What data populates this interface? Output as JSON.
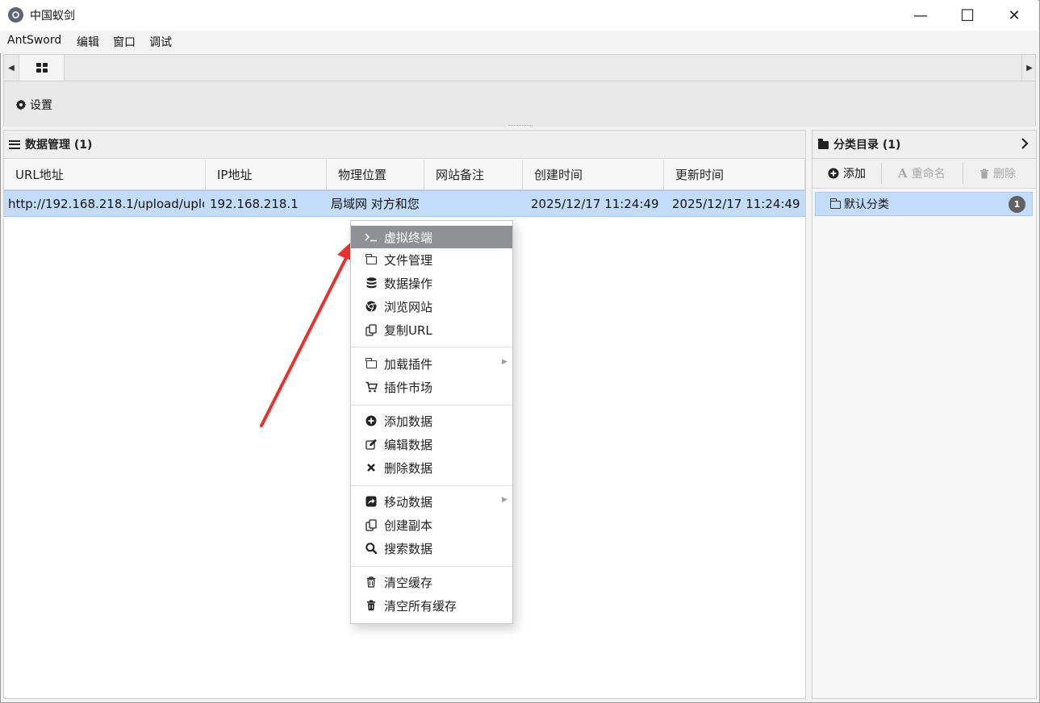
{
  "window": {
    "title": "中国蚁剑",
    "controls": {
      "minimize": "—",
      "maximize": "☐",
      "close": "✕"
    }
  },
  "menubar": {
    "items": [
      "AntSword",
      "编辑",
      "窗口",
      "调试"
    ]
  },
  "tabs": {
    "left_arrow": "◀",
    "right_arrow": "▶",
    "home_icon": "grid-icon"
  },
  "toolbar": {
    "settings_label": "设置",
    "settings_icon": "gear-icon"
  },
  "data_panel": {
    "title": "数据管理 (1)",
    "columns": [
      "URL地址",
      "IP地址",
      "物理位置",
      "网站备注",
      "创建时间",
      "更新时间"
    ],
    "rows": [
      {
        "url": "http://192.168.218.1/upload/uplo",
        "ip": "192.168.218.1",
        "location": "局域网 对方和您",
        "note": "",
        "created": "2025/12/17 11:24:49",
        "updated": "2025/12/17 11:24:49"
      }
    ],
    "selected_row_color": "#c3dcf9"
  },
  "category_panel": {
    "title": "分类目录 (1)",
    "expand_icon": "chevron-right-icon",
    "toolbar": {
      "add_label": "添加",
      "rename_label": "重命名",
      "delete_label": "删除"
    },
    "items": [
      {
        "label": "默认分类",
        "count": "1"
      }
    ]
  },
  "context_menu": {
    "groups": [
      [
        {
          "label": "虚拟终端",
          "icon": "terminal-icon",
          "active": true
        },
        {
          "label": "文件管理",
          "icon": "folder-icon"
        },
        {
          "label": "数据操作",
          "icon": "database-icon"
        },
        {
          "label": "浏览网站",
          "icon": "chrome-icon"
        },
        {
          "label": "复制URL",
          "icon": "copy-icon"
        }
      ],
      [
        {
          "label": "加载插件",
          "icon": "folder-icon",
          "submenu": true
        },
        {
          "label": "插件市场",
          "icon": "cart-icon"
        }
      ],
      [
        {
          "label": "添加数据",
          "icon": "plus-circle-icon"
        },
        {
          "label": "编辑数据",
          "icon": "edit-icon"
        },
        {
          "label": "删除数据",
          "icon": "x-icon"
        }
      ],
      [
        {
          "label": "移动数据",
          "icon": "share-icon",
          "submenu": true
        },
        {
          "label": "创建副本",
          "icon": "copy-icon"
        },
        {
          "label": "搜索数据",
          "icon": "search-icon"
        }
      ],
      [
        {
          "label": "清空缓存",
          "icon": "trash-outline-icon"
        },
        {
          "label": "清空所有缓存",
          "icon": "trash-icon"
        }
      ]
    ],
    "active_color": "#8e9297"
  },
  "annotation": {
    "arrow_color": "#e8322f"
  }
}
